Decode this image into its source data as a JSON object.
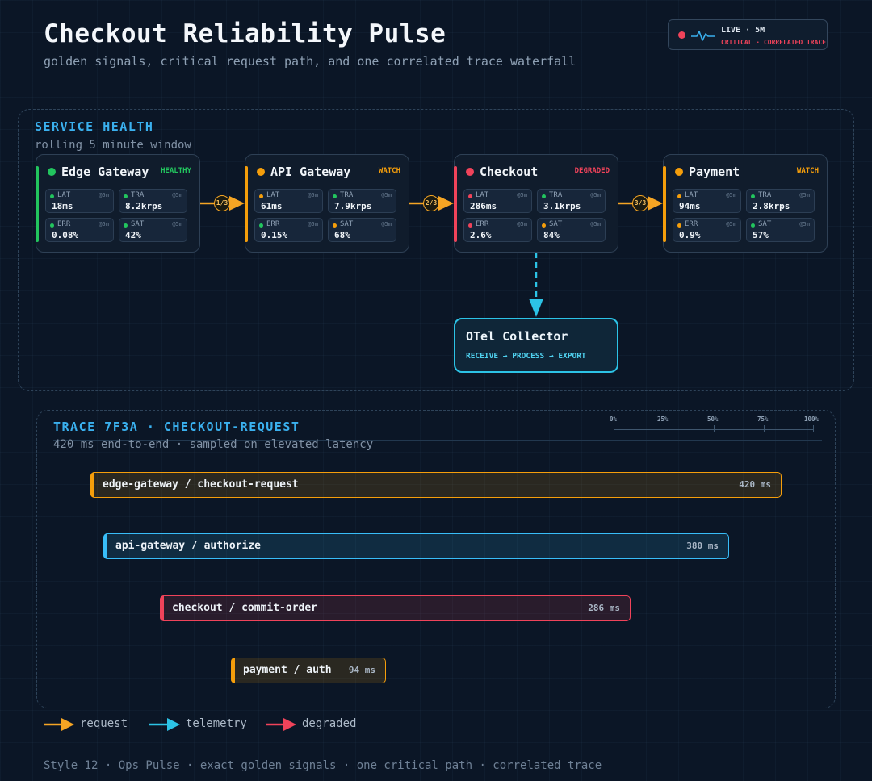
{
  "header": {
    "title": "Checkout Reliability Pulse",
    "subtitle": "golden signals, critical request path, and one correlated trace waterfall"
  },
  "live_badge": {
    "label": "LIVE · 5M",
    "sublabel": "CRITICAL · CORRELATED TRACE"
  },
  "service_health": {
    "title": "SERVICE HEALTH",
    "subtitle": "rolling 5 minute window",
    "services": [
      {
        "name": "Edge Gateway",
        "status": "HEALTHY",
        "color": "#22c55e",
        "metrics": [
          {
            "key": "LAT",
            "value": "18ms",
            "window": "@5m",
            "color": "#22c55e"
          },
          {
            "key": "TRA",
            "value": "8.2krps",
            "window": "@5m",
            "color": "#22c55e"
          },
          {
            "key": "ERR",
            "value": "0.08%",
            "window": "@5m",
            "color": "#22c55e"
          },
          {
            "key": "SAT",
            "value": "42%",
            "window": "@5m",
            "color": "#22c55e"
          }
        ]
      },
      {
        "name": "API Gateway",
        "status": "WATCH",
        "color": "#f59e0b",
        "metrics": [
          {
            "key": "LAT",
            "value": "61ms",
            "window": "@5m",
            "color": "#f59e0b"
          },
          {
            "key": "TRA",
            "value": "7.9krps",
            "window": "@5m",
            "color": "#22c55e"
          },
          {
            "key": "ERR",
            "value": "0.15%",
            "window": "@5m",
            "color": "#22c55e"
          },
          {
            "key": "SAT",
            "value": "68%",
            "window": "@5m",
            "color": "#f59e0b"
          }
        ]
      },
      {
        "name": "Checkout",
        "status": "DEGRADED",
        "color": "#f0435a",
        "metrics": [
          {
            "key": "LAT",
            "value": "286ms",
            "window": "@5m",
            "color": "#f0435a"
          },
          {
            "key": "TRA",
            "value": "3.1krps",
            "window": "@5m",
            "color": "#22c55e"
          },
          {
            "key": "ERR",
            "value": "2.6%",
            "window": "@5m",
            "color": "#f0435a"
          },
          {
            "key": "SAT",
            "value": "84%",
            "window": "@5m",
            "color": "#f59e0b"
          }
        ]
      },
      {
        "name": "Payment",
        "status": "WATCH",
        "color": "#f59e0b",
        "metrics": [
          {
            "key": "LAT",
            "value": "94ms",
            "window": "@5m",
            "color": "#f59e0b"
          },
          {
            "key": "TRA",
            "value": "2.8krps",
            "window": "@5m",
            "color": "#22c55e"
          },
          {
            "key": "ERR",
            "value": "0.9%",
            "window": "@5m",
            "color": "#f59e0b"
          },
          {
            "key": "SAT",
            "value": "57%",
            "window": "@5m",
            "color": "#22c55e"
          }
        ]
      }
    ],
    "hops": [
      "1/3",
      "2/3",
      "3/3"
    ],
    "collector": {
      "name": "OTel Collector",
      "stages": "RECEIVE → PROCESS → EXPORT"
    }
  },
  "trace": {
    "title": "TRACE 7F3A · CHECKOUT-REQUEST",
    "subtitle": "420 ms end-to-end · sampled on elevated latency",
    "scale": [
      "0%",
      "25%",
      "50%",
      "75%",
      "100%"
    ],
    "spans": [
      {
        "label": "edge-gateway / checkout-request",
        "duration": "420 ms",
        "color": "#f59e0b"
      },
      {
        "label": "api-gateway / authorize",
        "duration": "380 ms",
        "color": "#38bdf8"
      },
      {
        "label": "checkout / commit-order",
        "duration": "286 ms",
        "color": "#f0435a"
      },
      {
        "label": "payment / auth",
        "duration": "94 ms",
        "color": "#f59e0b"
      }
    ]
  },
  "legend": [
    {
      "label": "request",
      "color": "#f5a524"
    },
    {
      "label": "telemetry",
      "color": "#2cc3e6"
    },
    {
      "label": "degraded",
      "color": "#f0435a"
    }
  ],
  "footer": "Style 12 · Ops Pulse · exact golden signals · one critical path · correlated trace"
}
